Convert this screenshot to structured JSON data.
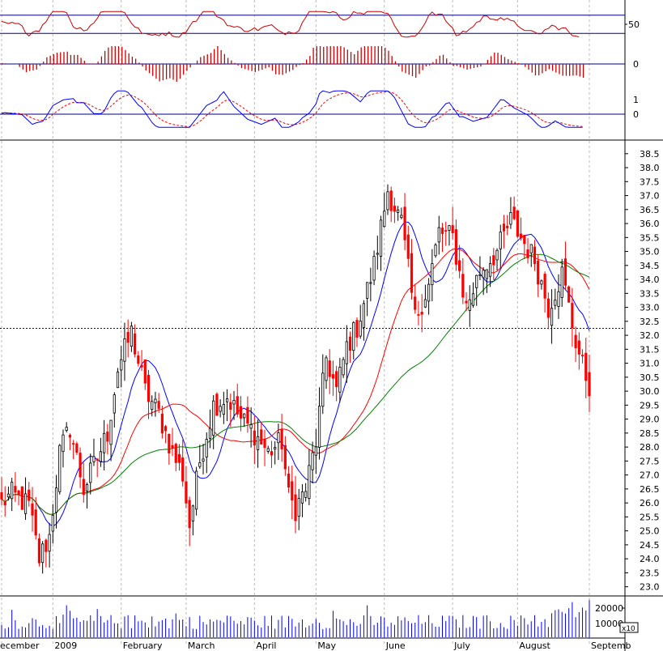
{
  "chart_data": {
    "type": "candlestick",
    "title": "",
    "price_axis": {
      "ylim": [
        22.7,
        38.9
      ],
      "ticks": [
        23.0,
        23.5,
        24.0,
        24.5,
        25.0,
        25.5,
        26.0,
        26.5,
        27.0,
        27.5,
        28.0,
        28.5,
        29.0,
        29.5,
        30.0,
        30.5,
        31.0,
        31.5,
        32.0,
        32.5,
        33.0,
        33.5,
        34.0,
        34.5,
        35.0,
        35.5,
        36.0,
        36.5,
        37.0,
        37.5,
        38.0,
        38.5
      ],
      "tick_labels": [
        "23.0",
        "23.5",
        "24.0",
        "24.5",
        "25.0",
        "25.5",
        "26.0",
        "26.5",
        "27.0",
        "27.5",
        "28.0",
        "28.5",
        "29.0",
        "29.5",
        "30.0",
        "30.5",
        "31.0",
        "31.5",
        "32.0",
        "32.5",
        "33.0",
        "33.5",
        "34.0",
        "34.5",
        "35.0",
        "35.5",
        "36.0",
        "36.5",
        "37.0",
        "37.5",
        "38.0",
        "38.5"
      ],
      "reference_line": 32.25
    },
    "month_labels": [
      "ecember",
      "2009",
      "February",
      "March",
      "April",
      "May",
      "June",
      "July",
      "August",
      "Septemb"
    ],
    "month_dividers": [
      0,
      15,
      35,
      54,
      74,
      92,
      112,
      132,
      151,
      172
    ],
    "n_days": 173,
    "close_keypoints": [
      [
        0,
        26.0
      ],
      [
        3,
        26.3
      ],
      [
        8,
        25.9
      ],
      [
        11,
        24.0
      ],
      [
        14,
        24.8
      ],
      [
        17,
        27.8
      ],
      [
        20,
        28.7
      ],
      [
        24,
        26.5
      ],
      [
        28,
        27.6
      ],
      [
        31,
        28.5
      ],
      [
        34,
        30.8
      ],
      [
        38,
        32.1
      ],
      [
        42,
        30.0
      ],
      [
        46,
        29.2
      ],
      [
        50,
        27.8
      ],
      [
        53,
        27.0
      ],
      [
        55,
        25.2
      ],
      [
        58,
        27.5
      ],
      [
        62,
        29.5
      ],
      [
        66,
        29.8
      ],
      [
        70,
        29.0
      ],
      [
        74,
        28.5
      ],
      [
        78,
        27.8
      ],
      [
        82,
        28.2
      ],
      [
        84,
        26.2
      ],
      [
        86,
        25.8
      ],
      [
        89,
        26.5
      ],
      [
        92,
        28.2
      ],
      [
        95,
        31.2
      ],
      [
        98,
        30.0
      ],
      [
        101,
        31.6
      ],
      [
        104,
        32.3
      ],
      [
        109,
        34.5
      ],
      [
        113,
        37.2
      ],
      [
        117,
        36.0
      ],
      [
        121,
        32.6
      ],
      [
        125,
        33.8
      ],
      [
        128,
        35.7
      ],
      [
        132,
        35.5
      ],
      [
        136,
        33.0
      ],
      [
        140,
        34.3
      ],
      [
        145,
        35.0
      ],
      [
        149,
        36.1
      ],
      [
        152,
        35.5
      ],
      [
        156,
        34.7
      ],
      [
        160,
        33.0
      ],
      [
        164,
        34.2
      ],
      [
        168,
        31.8
      ],
      [
        170,
        30.9
      ],
      [
        172,
        30.2
      ]
    ],
    "series": [
      {
        "name": "",
        "role": "price",
        "color_up": "#000000",
        "color_down": "#ff0000"
      },
      {
        "name": "",
        "role": "moving_average_short",
        "color": "#0000ff",
        "period": 10
      },
      {
        "name": "",
        "role": "moving_average_mid",
        "color": "#ff0000",
        "period": 25
      },
      {
        "name": "",
        "role": "moving_average_long",
        "color": "#008000",
        "period": 50
      }
    ],
    "indicator_rsi": {
      "axis_labels": [
        "50"
      ],
      "upper": 70,
      "lower": 30,
      "color": "#cc0000"
    },
    "indicator_histogram": {
      "axis_labels": [
        "0"
      ],
      "color": "#cc0000"
    },
    "indicator_oscillator": {
      "axis_labels": [
        "1",
        "0"
      ],
      "line_color": "#0000ff",
      "signal_color": "#ff0000"
    },
    "volume": {
      "axis_labels": [
        "20000",
        "10000"
      ],
      "unit_label": "x10",
      "color": "#0000ff"
    }
  }
}
